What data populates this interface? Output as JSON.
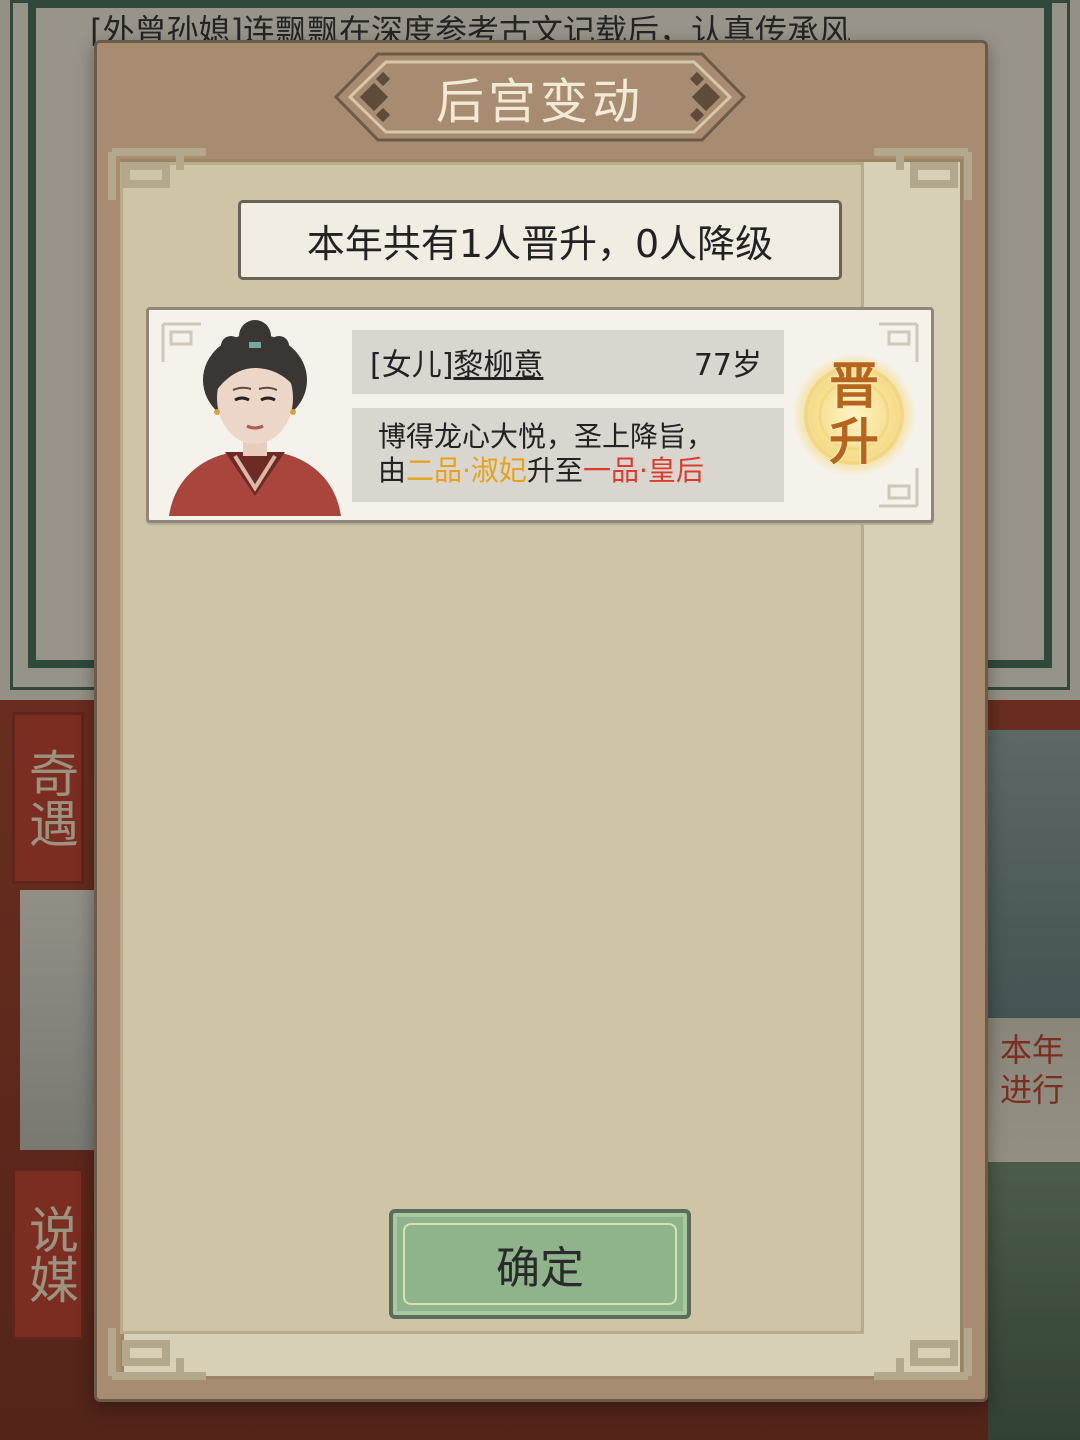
{
  "background": {
    "ticker_text": "[外曾孙媳]连飘飘在深度参考古文记载后，认真传承风",
    "side_tags": [
      "奇遇",
      "说媒"
    ],
    "right_text": "本年\n进行"
  },
  "dialog": {
    "title": "后宫变动",
    "summary": "本年共有1人晋升，0人降级",
    "events": [
      {
        "relation": "[女儿]",
        "name": "黎柳意",
        "age": "77岁",
        "desc_line1": "博得龙心大悦，圣上降旨，",
        "desc_from_prefix": "由",
        "from_rank": "二品·淑妃",
        "desc_to_prefix": "升至",
        "to_rank": "一品·皇后",
        "badge": "晋升"
      }
    ],
    "confirm_label": "确定"
  },
  "colors": {
    "from_rank": "#e6a319",
    "to_rank": "#e03a2c",
    "button": "#8fb38a",
    "plaque": "#a88c72"
  }
}
